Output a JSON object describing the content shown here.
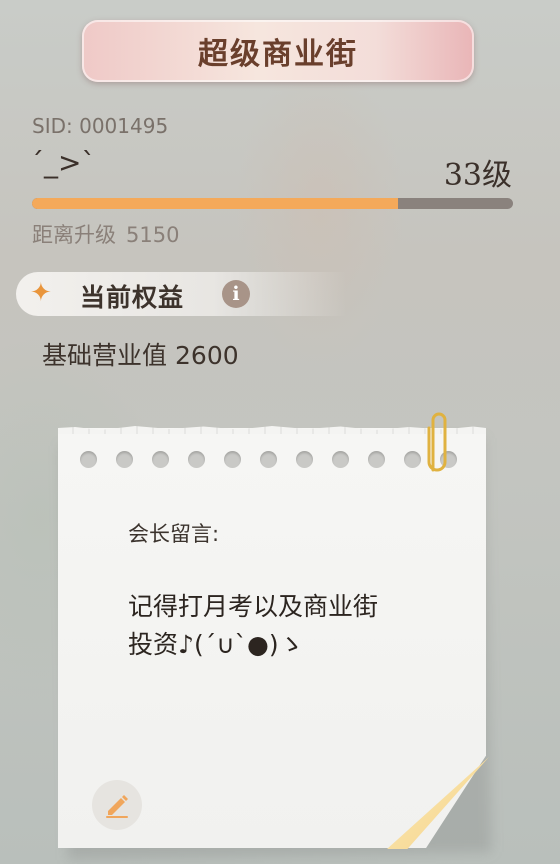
{
  "header": {
    "title": "超级商业街"
  },
  "profile": {
    "sid_label": "SID:",
    "sid": "0001495",
    "nickname": "´_>`",
    "level": "33级",
    "progress_fraction": 0.76,
    "next_level_label": "距离升级",
    "next_level_value": "5150"
  },
  "benefits": {
    "header": "当前权益",
    "value_label": "基础营业值",
    "value": "2600"
  },
  "note": {
    "title": "会长留言:",
    "body": "记得打月考以及商业街\n投资♪(´∪`●)ゝ"
  },
  "colors": {
    "accent": "#f4a95a",
    "title_text": "#6a3f2c",
    "text_dark": "#3b302a"
  },
  "icons": {
    "benefit": "sparkle-icon",
    "info": "info-icon",
    "clip": "paperclip-icon",
    "edit": "pencil-icon"
  }
}
